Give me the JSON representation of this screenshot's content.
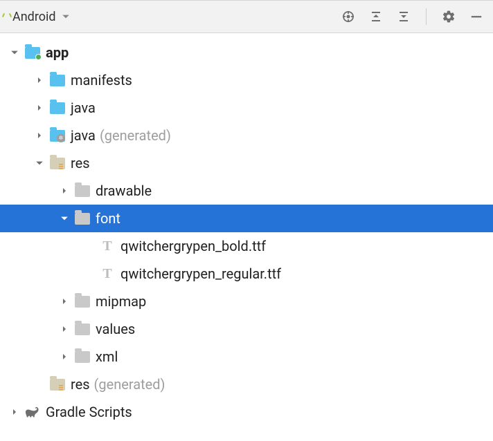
{
  "toolbar": {
    "title": "Android"
  },
  "tree": {
    "app": "app",
    "manifests": "manifests",
    "java": "java",
    "java_gen": "java",
    "java_gen_suffix": "(generated)",
    "res": "res",
    "drawable": "drawable",
    "font": "font",
    "font_file1": "qwitchergrypen_bold.ttf",
    "font_file2": "qwitchergrypen_regular.ttf",
    "mipmap": "mipmap",
    "values": "values",
    "xml": "xml",
    "res_gen": "res",
    "res_gen_suffix": "(generated)",
    "gradle": "Gradle Scripts"
  }
}
